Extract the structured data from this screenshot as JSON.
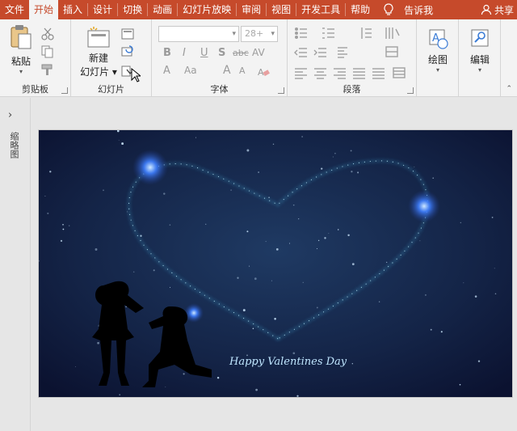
{
  "tabs": [
    "文件",
    "开始",
    "插入",
    "设计",
    "切换",
    "动画",
    "幻灯片放映",
    "审阅",
    "视图",
    "开发工具",
    "帮助"
  ],
  "active_tab": 1,
  "tell_me": "告诉我",
  "share": "共享",
  "clipboard": {
    "paste": "粘贴",
    "label": "剪贴板"
  },
  "slides": {
    "new_line1": "新建",
    "new_line2": "幻灯片",
    "label": "幻灯片"
  },
  "font": {
    "size_value": "28+",
    "label": "字体",
    "glyphs": [
      "B",
      "I",
      "U",
      "S",
      "abc",
      "AV",
      "A",
      "Aa",
      "A",
      "A"
    ]
  },
  "paragraph": {
    "label": "段落"
  },
  "drawing": {
    "label": "绘图"
  },
  "editing": {
    "label": "编辑"
  },
  "sidebar": {
    "thumbnails_label": "缩略图"
  },
  "slide": {
    "caption": "Happy Valentines Day"
  },
  "colors": {
    "accent": "#c64a2b",
    "slide_bg": "#101a3a",
    "heart_glow": "#4fd0ff"
  }
}
